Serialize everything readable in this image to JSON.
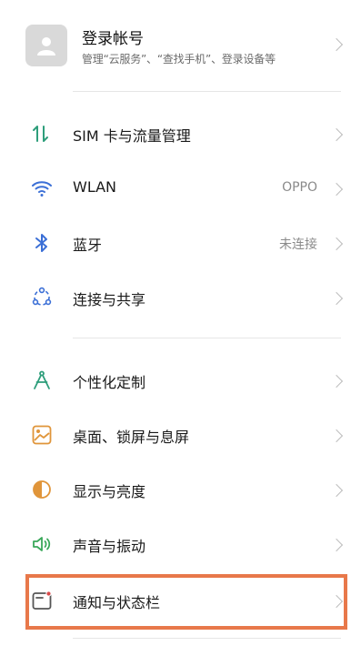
{
  "account": {
    "title": "登录帐号",
    "subtitle": "管理“云服务”、“查找手机”、登录设备等"
  },
  "groups": [
    {
      "items": [
        {
          "label": "SIM 卡与流量管理",
          "value": "",
          "icon": "sim-data-icon",
          "color": "#2e9e7b"
        },
        {
          "label": "WLAN",
          "value": "OPPO",
          "icon": "wifi-icon",
          "color": "#3b6fd6"
        },
        {
          "label": "蓝牙",
          "value": "未连接",
          "icon": "bluetooth-icon",
          "color": "#3b6fd6"
        },
        {
          "label": "连接与共享",
          "value": "",
          "icon": "share-connection-icon",
          "color": "#3b6fd6"
        }
      ]
    },
    {
      "items": [
        {
          "label": "个性化定制",
          "value": "",
          "icon": "compass-icon",
          "color": "#2e9e7b"
        },
        {
          "label": "桌面、锁屏与息屏",
          "value": "",
          "icon": "wallpaper-icon",
          "color": "#e0953a"
        },
        {
          "label": "显示与亮度",
          "value": "",
          "icon": "brightness-icon",
          "color": "#e0953a"
        },
        {
          "label": "声音与振动",
          "value": "",
          "icon": "speaker-icon",
          "color": "#3aa85a"
        },
        {
          "label": "通知与状态栏",
          "value": "",
          "icon": "notification-icon",
          "color": "#d94a4a"
        }
      ]
    }
  ],
  "highlight_color": "#e8784a"
}
